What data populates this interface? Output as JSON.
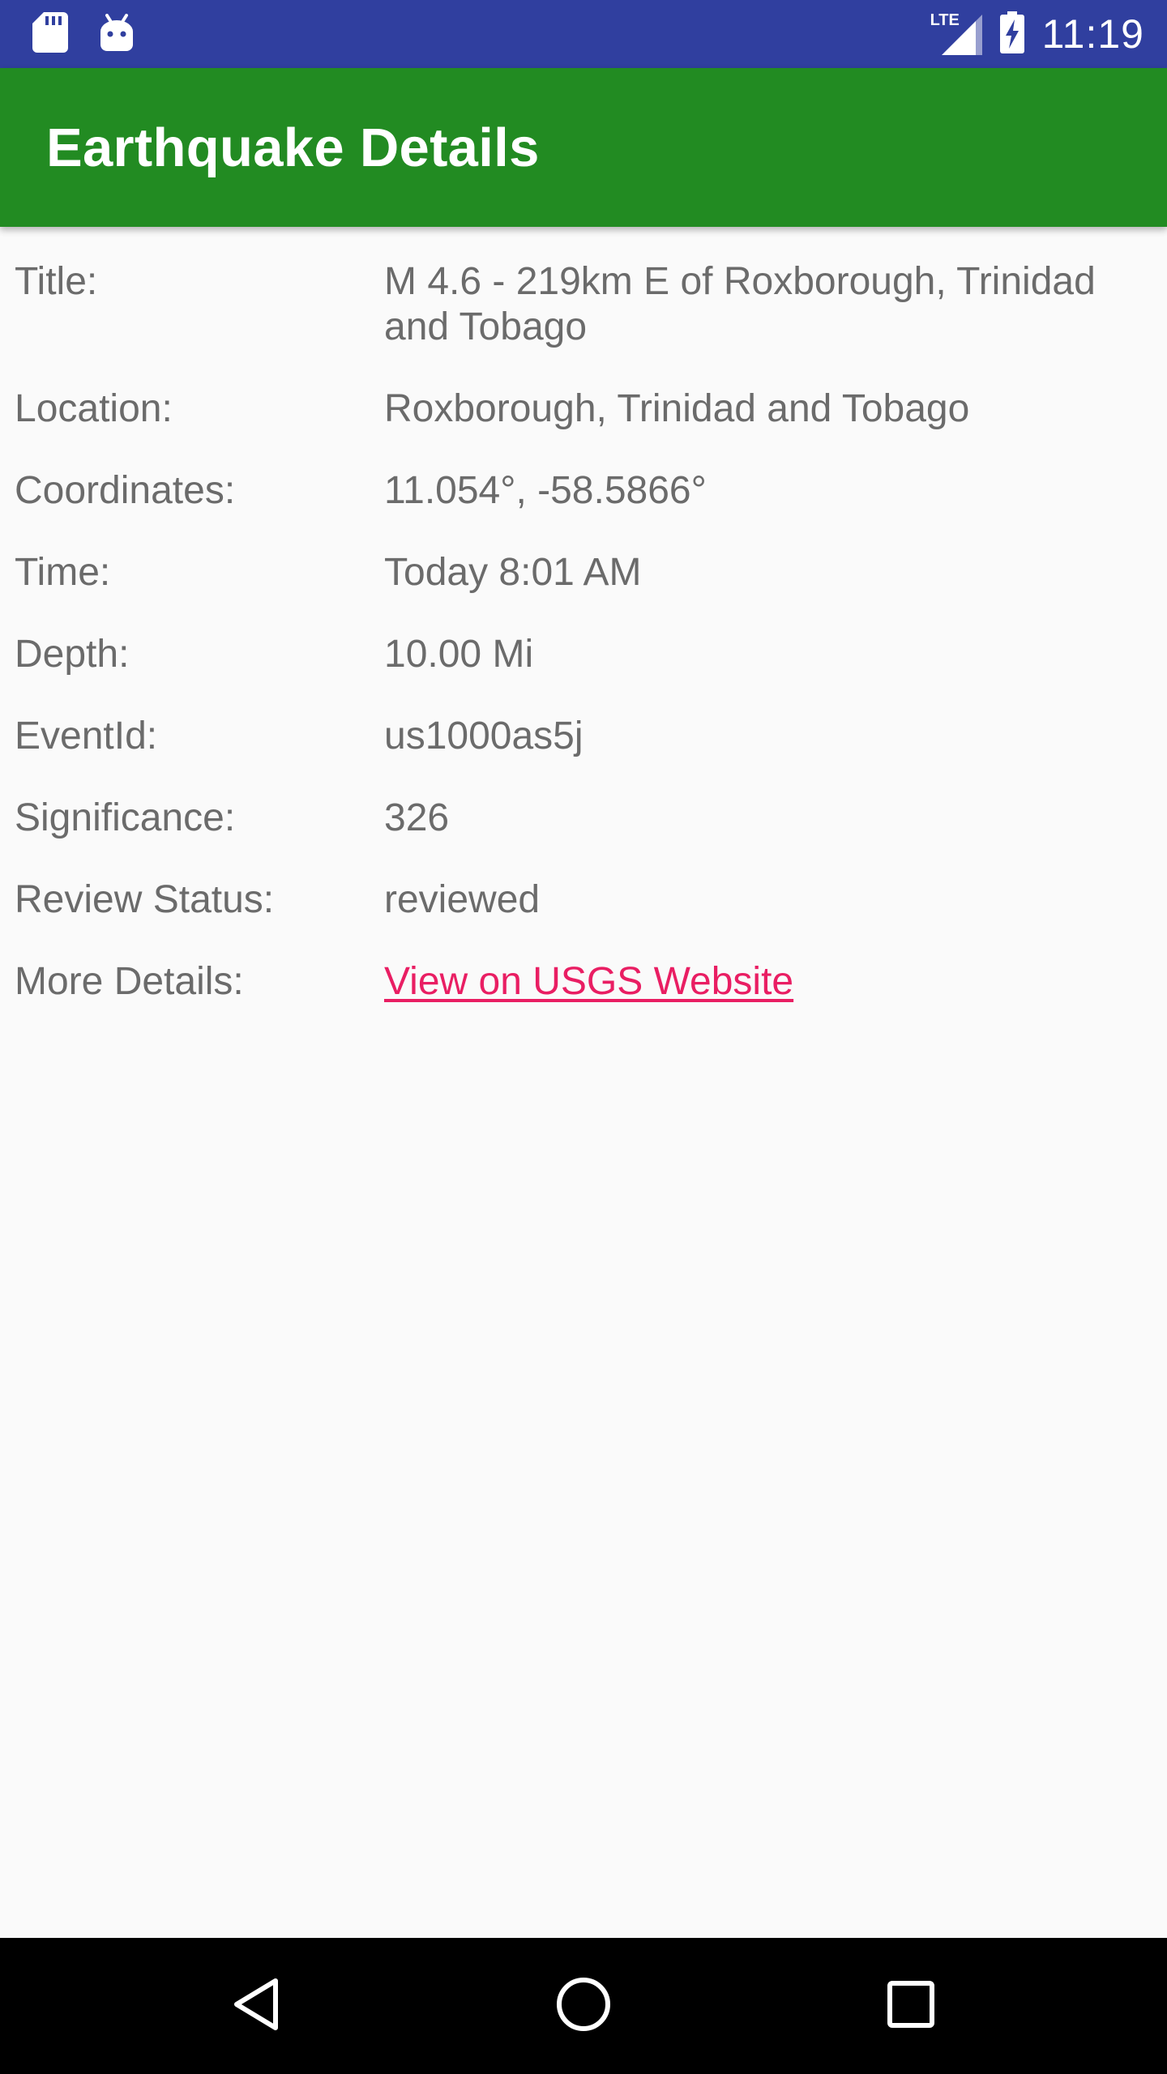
{
  "status_bar": {
    "time": "11:19",
    "network_type": "LTE",
    "icons": [
      "sd-card-icon",
      "android-icon",
      "signal-icon",
      "battery-charging-icon"
    ]
  },
  "app_bar": {
    "title": "Earthquake Details",
    "background_color": "#228b22"
  },
  "details": [
    {
      "label": "Title:",
      "value": "M 4.6 - 219km E of Roxborough, Trinidad and Tobago"
    },
    {
      "label": "Location:",
      "value": "Roxborough, Trinidad and Tobago"
    },
    {
      "label": "Coordinates:",
      "value": "11.054°, -58.5866°"
    },
    {
      "label": "Time:",
      "value": "Today 8:01 AM"
    },
    {
      "label": "Depth:",
      "value": "10.00 Mi"
    },
    {
      "label": "EventId:",
      "value": "us1000as5j"
    },
    {
      "label": "Significance:",
      "value": "326"
    },
    {
      "label": "Review Status:",
      "value": "reviewed"
    },
    {
      "label": "More Details:",
      "value": "View on USGS Website",
      "is_link": true
    }
  ],
  "nav_bar": {
    "icons": [
      "back-icon",
      "home-icon",
      "recents-icon"
    ]
  },
  "colors": {
    "status_bar": "#303f9f",
    "link": "#e91e63",
    "text": "#6b6b6b",
    "background": "#fafafa"
  }
}
